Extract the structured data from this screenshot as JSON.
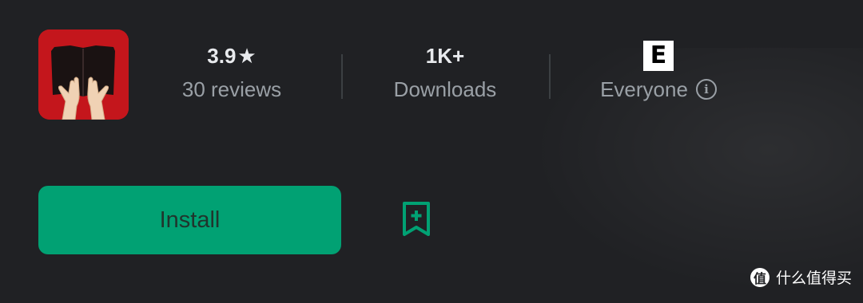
{
  "app": {
    "icon_name": "book-hands-app-icon",
    "icon_color": "#c4161c"
  },
  "stats": {
    "rating": {
      "value": "3.9",
      "star_icon": "star-icon",
      "label": "30 reviews"
    },
    "downloads": {
      "value": "1K+",
      "label": "Downloads"
    },
    "content_rating": {
      "badge": "E",
      "label": "Everyone",
      "info_icon": "info-icon"
    }
  },
  "actions": {
    "install_label": "Install",
    "install_color": "#01a173",
    "wishlist_icon": "bookmark-add-icon",
    "wishlist_color": "#01a173"
  },
  "watermark": {
    "logo_text": "值",
    "text": "什么值得买"
  }
}
